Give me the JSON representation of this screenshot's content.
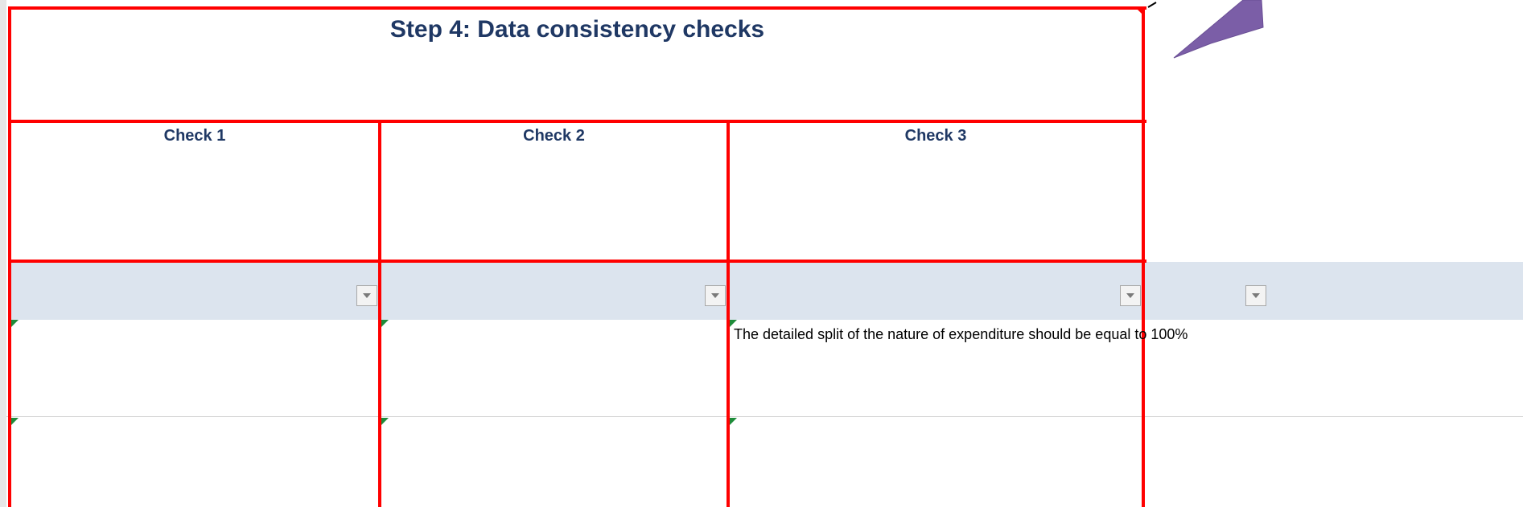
{
  "header": {
    "title": "Step 4: Data consistency checks"
  },
  "columns": [
    {
      "label": "Check 1"
    },
    {
      "label": "Check 2"
    },
    {
      "label": "Check 3"
    }
  ],
  "notes": {
    "check3": "The detailed split of the nature of expenditure should be equal to 100%"
  },
  "icons": {
    "filter": "dropdown-arrow-icon",
    "indicator": "comment-indicator-icon",
    "shape": "purple-callout-shape"
  },
  "colors": {
    "border": "#ff0000",
    "title": "#1f3864",
    "band": "#dce4ee",
    "callout": "#7b5ea7"
  }
}
